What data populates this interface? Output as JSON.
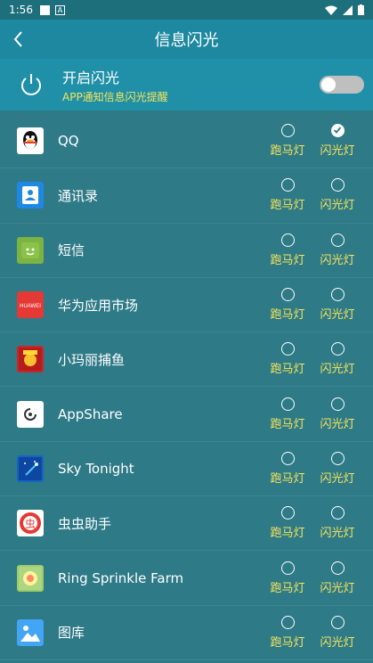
{
  "status_bar": {
    "time": "1:56"
  },
  "header": {
    "title": "信息闪光"
  },
  "master": {
    "title": "开启闪光",
    "subtitle": "APP通知信息闪光提醒",
    "enabled": false
  },
  "option_labels": {
    "marquee": "跑马灯",
    "flash": "闪光灯"
  },
  "apps": [
    {
      "name": "QQ",
      "icon": "qq-icon",
      "color": "#ffffff",
      "marquee": false,
      "flash": true
    },
    {
      "name": "通讯录",
      "icon": "contacts-icon",
      "color": "#1e88e5",
      "marquee": false,
      "flash": false
    },
    {
      "name": "短信",
      "icon": "messages-icon",
      "color": "#7cb342",
      "marquee": false,
      "flash": false
    },
    {
      "name": "华为应用市场",
      "icon": "huawei-appgallery-icon",
      "color": "#e53935",
      "marquee": false,
      "flash": false
    },
    {
      "name": "小玛丽捕鱼",
      "icon": "fishing-game-icon",
      "color": "#c62828",
      "marquee": false,
      "flash": false
    },
    {
      "name": "AppShare",
      "icon": "appshare-icon",
      "color": "#ffffff",
      "marquee": false,
      "flash": false
    },
    {
      "name": "Sky Tonight",
      "icon": "sky-tonight-icon",
      "color": "#1565c0",
      "marquee": false,
      "flash": false
    },
    {
      "name": "虫虫助手",
      "icon": "chongchong-icon",
      "color": "#ffffff",
      "marquee": false,
      "flash": false
    },
    {
      "name": "Ring Sprinkle Farm",
      "icon": "farm-game-icon",
      "color": "#9ccc65",
      "marquee": false,
      "flash": false
    },
    {
      "name": "图库",
      "icon": "gallery-icon",
      "color": "#42a5f5",
      "marquee": false,
      "flash": false
    }
  ]
}
